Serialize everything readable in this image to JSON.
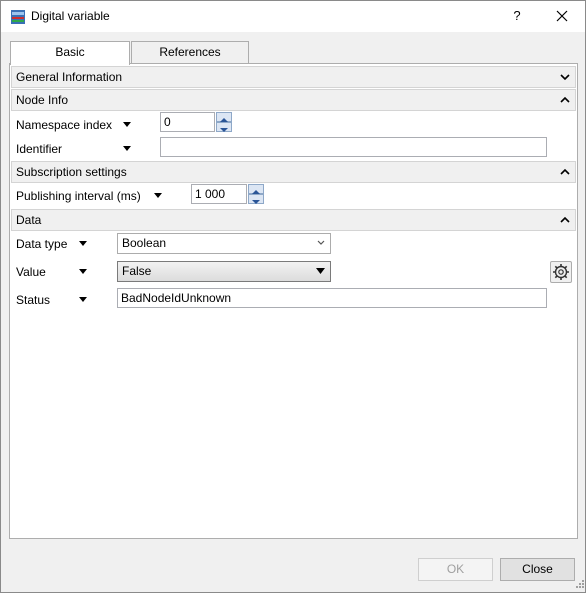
{
  "window": {
    "title": "Digital variable",
    "help_label": "?"
  },
  "tabs": [
    {
      "label": "Basic"
    },
    {
      "label": "References"
    }
  ],
  "sections": {
    "general": {
      "label": "General Information"
    },
    "node_info": {
      "label": "Node Info",
      "namespace_label": "Namespace index",
      "namespace_value": "0",
      "identifier_label": "Identifier",
      "identifier_value": ""
    },
    "subscription": {
      "label": "Subscription settings",
      "interval_label": "Publishing interval (ms)",
      "interval_value": "1 000"
    },
    "data": {
      "label": "Data",
      "type_label": "Data type",
      "type_value": "Boolean",
      "value_label": "Value",
      "value_value": "False",
      "status_label": "Status",
      "status_value": "BadNodeIdUnknown"
    }
  },
  "footer": {
    "ok_label": "OK",
    "close_label": "Close"
  }
}
